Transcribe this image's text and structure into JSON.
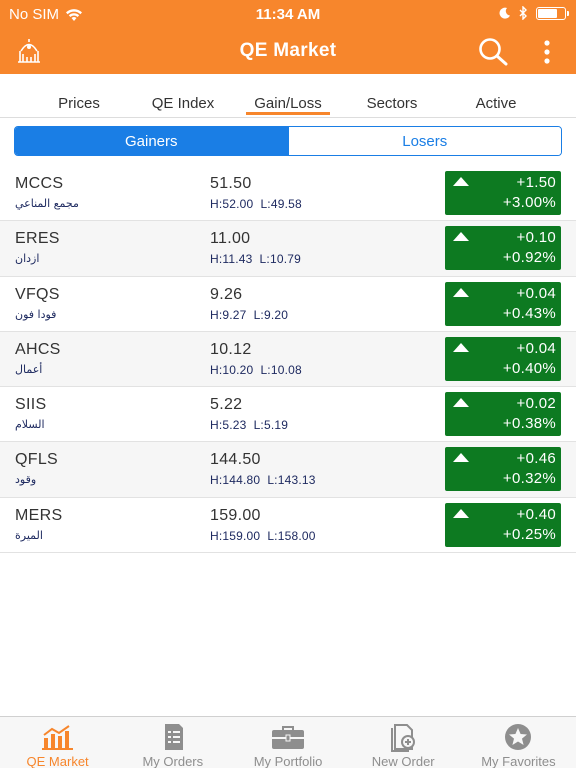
{
  "status_bar": {
    "carrier": "No SIM",
    "time": "11:34 AM",
    "battery_level": 0.8
  },
  "nav": {
    "title": "QE Market"
  },
  "tabs": [
    {
      "label": "Prices",
      "active": false
    },
    {
      "label": "QE Index",
      "active": false
    },
    {
      "label": "Gain/Loss",
      "active": true
    },
    {
      "label": "Sectors",
      "active": false
    },
    {
      "label": "Active",
      "active": false
    }
  ],
  "segment": {
    "gainers_label": "Gainers",
    "losers_label": "Losers",
    "selected": "Gainers"
  },
  "stocks": [
    {
      "symbol": "MCCS",
      "name_ar": "مجمع المناعي",
      "last": "51.50",
      "high": "H:52.00",
      "low": "L:49.58",
      "change": "+1.50",
      "change_pct": "+3.00%"
    },
    {
      "symbol": "ERES",
      "name_ar": "ازدان",
      "last": "11.00",
      "high": "H:11.43",
      "low": "L:10.79",
      "change": "+0.10",
      "change_pct": "+0.92%"
    },
    {
      "symbol": "VFQS",
      "name_ar": "فودا فون",
      "last": "9.26",
      "high": "H:9.27",
      "low": "L:9.20",
      "change": "+0.04",
      "change_pct": "+0.43%"
    },
    {
      "symbol": "AHCS",
      "name_ar": "أعمال",
      "last": "10.12",
      "high": "H:10.20",
      "low": "L:10.08",
      "change": "+0.04",
      "change_pct": "+0.40%"
    },
    {
      "symbol": "SIIS",
      "name_ar": "السلام",
      "last": "5.22",
      "high": "H:5.23",
      "low": "L:5.19",
      "change": "+0.02",
      "change_pct": "+0.38%"
    },
    {
      "symbol": "QFLS",
      "name_ar": "وقود",
      "last": "144.50",
      "high": "H:144.80",
      "low": "L:143.13",
      "change": "+0.46",
      "change_pct": "+0.32%"
    },
    {
      "symbol": "MERS",
      "name_ar": "الميرة",
      "last": "159.00",
      "high": "H:159.00",
      "low": "L:158.00",
      "change": "+0.40",
      "change_pct": "+0.25%"
    }
  ],
  "tab_bar": [
    {
      "label": "QE Market",
      "icon": "market-chart-icon",
      "active": true
    },
    {
      "label": "My Orders",
      "icon": "orders-list-icon",
      "active": false
    },
    {
      "label": "My Portfolio",
      "icon": "briefcase-icon",
      "active": false
    },
    {
      "label": "New Order",
      "icon": "new-order-icon",
      "active": false
    },
    {
      "label": "My Favorites",
      "icon": "star-icon",
      "active": false
    }
  ],
  "colors": {
    "brand_orange": "#f7862c",
    "segment_blue": "#1a7ee5",
    "gain_green": "#0d7a21"
  }
}
